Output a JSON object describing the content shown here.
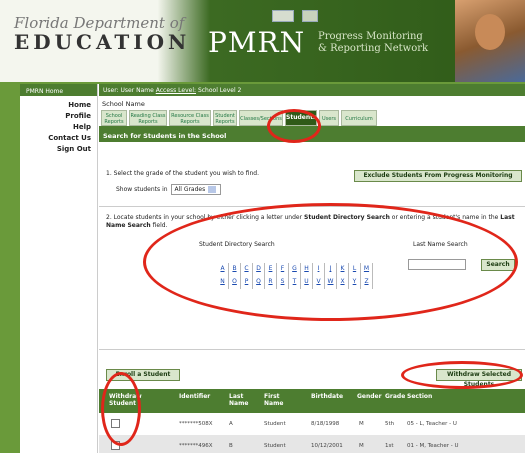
{
  "header": {
    "fl_top": "Florida Department of",
    "fl_edu": "EDUCATION",
    "pmrn": "PMRN",
    "pmrn_sub_1": "Progress Monitoring",
    "pmrn_sub_2": "& Reporting Network"
  },
  "sidebar": {
    "title": "PMRN Home",
    "links": [
      "Home",
      "Profile",
      "Help",
      "Contact Us",
      "Sign Out"
    ]
  },
  "userbar": {
    "user": "User: User Name",
    "access_level": "Access Level:",
    "school_level": "School Level 2"
  },
  "school_name": "School Name",
  "tabs": [
    {
      "line1": "School",
      "line2": "Reports"
    },
    {
      "line1": "Reading Class",
      "line2": "Reports"
    },
    {
      "line1": "Resource Class",
      "line2": "Reports"
    },
    {
      "line1": "Student",
      "line2": "Reports"
    },
    {
      "line1": "Classes/Sections",
      "line2": ""
    },
    {
      "line1": "Students",
      "line2": ""
    },
    {
      "line1": "Users",
      "line2": ""
    },
    {
      "line1": "Curriculum",
      "line2": ""
    }
  ],
  "section_title": "Search for Students in the School",
  "step1": "1. Select the grade of the student you wish to find.",
  "show_label": "Show students in",
  "grade_select": "All Grades",
  "exclude_button": "Exclude Students From Progress Monitoring",
  "step2_a": "2. Locate students in your school by either clicking a letter under ",
  "step2_b": "Student Directory Search",
  "step2_c": " or entering a student's name in the ",
  "step2_d": "Last Name Search",
  "step2_e": " field.",
  "sds_label": "Student Directory Search",
  "ln_label": "Last Name Search",
  "letters_row1": [
    "A",
    "B",
    "C",
    "D",
    "E",
    "F",
    "G",
    "H",
    "I",
    "J",
    "K",
    "L",
    "M"
  ],
  "letters_row2": [
    "N",
    "O",
    "P",
    "Q",
    "R",
    "S",
    "T",
    "U",
    "V",
    "W",
    "X",
    "Y",
    "Z"
  ],
  "search_button": "Search",
  "enroll_button": "Enroll a Student",
  "withdraw_button": "Withdraw Selected Students",
  "table": {
    "headers": [
      "Withdraw Student",
      "Identifier",
      "Last Name",
      "First Name",
      "Birthdate",
      "Gender",
      "Grade",
      "Section"
    ],
    "rows": [
      [
        "",
        "*******508X",
        "A",
        "Student",
        "8/18/1998",
        "M",
        "5th",
        "05 - L, Teacher - U"
      ],
      [
        "",
        "*******496X",
        "B",
        "Student",
        "10/12/2001",
        "M",
        "1st",
        "01 - M, Teacher - U"
      ]
    ]
  },
  "colors": {
    "accent": "#4d7d30",
    "highlight": "#e0261a"
  }
}
